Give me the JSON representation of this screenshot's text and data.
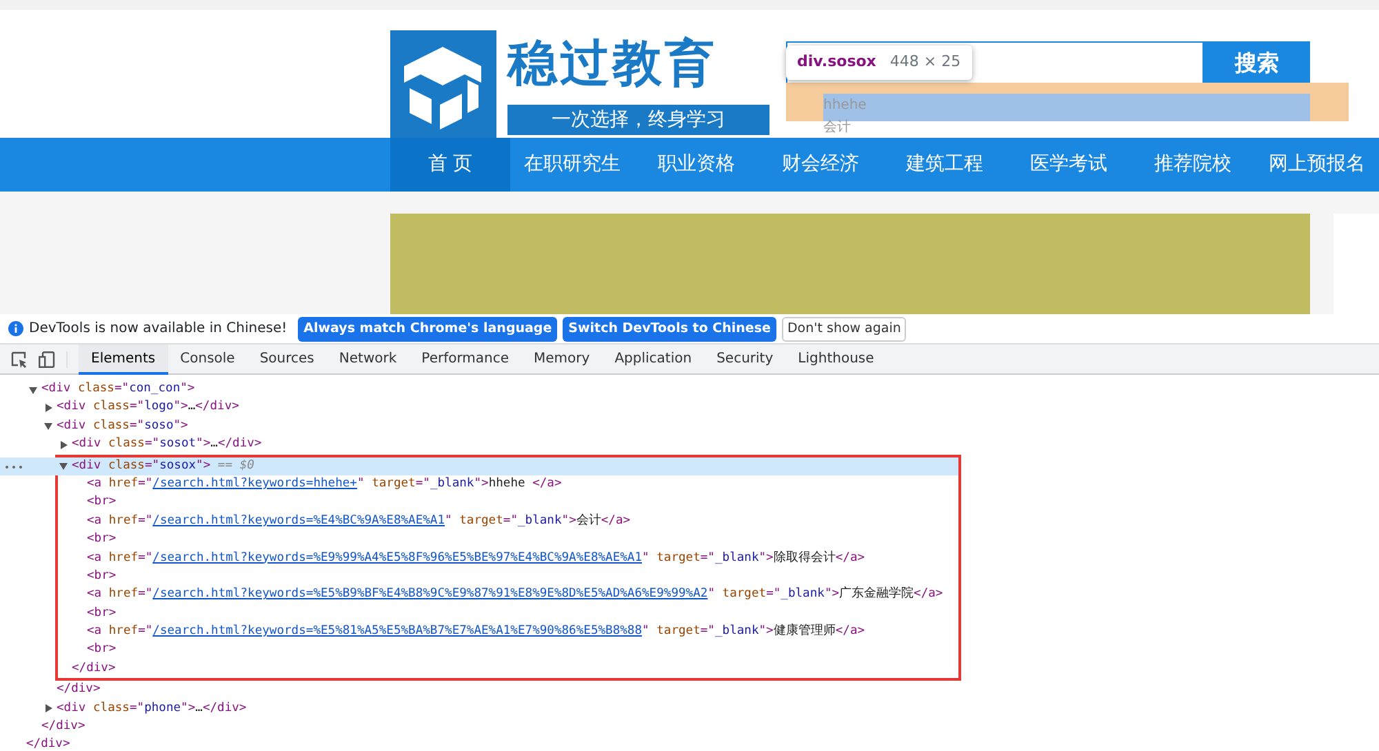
{
  "site": {
    "logo_title": "稳过教育",
    "slogan": "一次选择，终身学习",
    "search": {
      "button": "搜索",
      "tooltip": {
        "selector": "div.sosox",
        "size": "448 × 25"
      }
    },
    "suggestions": [
      "hhehe",
      "会计"
    ],
    "nav": [
      {
        "label": "首 页",
        "selected": true
      },
      {
        "label": "在职研究生",
        "selected": false
      },
      {
        "label": "职业资格",
        "selected": false
      },
      {
        "label": "财会经济",
        "selected": false
      },
      {
        "label": "建筑工程",
        "selected": false
      },
      {
        "label": "医学考试",
        "selected": false
      },
      {
        "label": "推荐院校",
        "selected": false
      },
      {
        "label": "网上预报名",
        "selected": false
      }
    ]
  },
  "infobar": {
    "message": "DevTools is now available in Chinese!",
    "buttons": [
      {
        "label": "Always match Chrome's language",
        "kind": "primary"
      },
      {
        "label": "Switch DevTools to Chinese",
        "kind": "primary"
      },
      {
        "label": "Don't show again",
        "kind": "secondary"
      }
    ]
  },
  "devtools_tabs": [
    {
      "label": "Elements",
      "selected": true
    },
    {
      "label": "Console",
      "selected": false
    },
    {
      "label": "Sources",
      "selected": false
    },
    {
      "label": "Network",
      "selected": false
    },
    {
      "label": "Performance",
      "selected": false
    },
    {
      "label": "Memory",
      "selected": false
    },
    {
      "label": "Application",
      "selected": false
    },
    {
      "label": "Security",
      "selected": false
    },
    {
      "label": "Lighthouse",
      "selected": false
    }
  ],
  "dom": {
    "nodes": [
      {
        "expanded": true,
        "selected": false,
        "highlighted": false,
        "parts": [
          {
            "kind": "tag",
            "text": "<div "
          },
          {
            "kind": "attr",
            "text": "class"
          },
          {
            "kind": "tag",
            "text": "=\""
          },
          {
            "kind": "val",
            "text": "con_con"
          },
          {
            "kind": "tag",
            "text": "\">"
          }
        ],
        "closing": "</div>",
        "children": [
          {
            "expanded": false,
            "selected": false,
            "highlighted": false,
            "parts": [
              {
                "kind": "tag",
                "text": "<div "
              },
              {
                "kind": "attr",
                "text": "class"
              },
              {
                "kind": "tag",
                "text": "=\""
              },
              {
                "kind": "val",
                "text": "logo"
              },
              {
                "kind": "tag",
                "text": "\">"
              },
              {
                "kind": "text",
                "text": "…"
              },
              {
                "kind": "tag",
                "text": "</div>"
              }
            ]
          },
          {
            "expanded": true,
            "selected": false,
            "highlighted": false,
            "parts": [
              {
                "kind": "tag",
                "text": "<div "
              },
              {
                "kind": "attr",
                "text": "class"
              },
              {
                "kind": "tag",
                "text": "=\""
              },
              {
                "kind": "val",
                "text": "soso"
              },
              {
                "kind": "tag",
                "text": "\">"
              }
            ],
            "closing": "</div>",
            "children": [
              {
                "expanded": false,
                "selected": false,
                "highlighted": false,
                "parts": [
                  {
                    "kind": "tag",
                    "text": "<div "
                  },
                  {
                    "kind": "attr",
                    "text": "class"
                  },
                  {
                    "kind": "tag",
                    "text": "=\""
                  },
                  {
                    "kind": "val",
                    "text": "sosot"
                  },
                  {
                    "kind": "tag",
                    "text": "\">"
                  },
                  {
                    "kind": "text",
                    "text": "…"
                  },
                  {
                    "kind": "tag",
                    "text": "</div>"
                  }
                ]
              },
              {
                "expanded": true,
                "selected": true,
                "highlighted": true,
                "parts": [
                  {
                    "kind": "tag",
                    "text": "<div "
                  },
                  {
                    "kind": "attr",
                    "text": "class"
                  },
                  {
                    "kind": "tag",
                    "text": "=\""
                  },
                  {
                    "kind": "val",
                    "text": "sosox"
                  },
                  {
                    "kind": "tag",
                    "text": "\">"
                  },
                  {
                    "kind": "dim",
                    "text": " == $0"
                  }
                ],
                "closing": "</div>",
                "children": [
                  {
                    "parts": [
                      {
                        "kind": "tag",
                        "text": "<a "
                      },
                      {
                        "kind": "attr",
                        "text": "href"
                      },
                      {
                        "kind": "tag",
                        "text": "=\""
                      },
                      {
                        "kind": "link",
                        "text": "/search.html?keywords=hhehe+"
                      },
                      {
                        "kind": "tag",
                        "text": "\" "
                      },
                      {
                        "kind": "attr",
                        "text": "target"
                      },
                      {
                        "kind": "tag",
                        "text": "=\""
                      },
                      {
                        "kind": "val",
                        "text": "_blank"
                      },
                      {
                        "kind": "tag",
                        "text": "\">"
                      },
                      {
                        "kind": "text",
                        "text": "hhehe "
                      },
                      {
                        "kind": "tag",
                        "text": "</a>"
                      }
                    ]
                  },
                  {
                    "parts": [
                      {
                        "kind": "tag",
                        "text": "<br>"
                      }
                    ]
                  },
                  {
                    "parts": [
                      {
                        "kind": "tag",
                        "text": "<a "
                      },
                      {
                        "kind": "attr",
                        "text": "href"
                      },
                      {
                        "kind": "tag",
                        "text": "=\""
                      },
                      {
                        "kind": "link",
                        "text": "/search.html?keywords=%E4%BC%9A%E8%AE%A1"
                      },
                      {
                        "kind": "tag",
                        "text": "\" "
                      },
                      {
                        "kind": "attr",
                        "text": "target"
                      },
                      {
                        "kind": "tag",
                        "text": "=\""
                      },
                      {
                        "kind": "val",
                        "text": "_blank"
                      },
                      {
                        "kind": "tag",
                        "text": "\">"
                      },
                      {
                        "kind": "text",
                        "text": "会计"
                      },
                      {
                        "kind": "tag",
                        "text": "</a>"
                      }
                    ]
                  },
                  {
                    "parts": [
                      {
                        "kind": "tag",
                        "text": "<br>"
                      }
                    ]
                  },
                  {
                    "parts": [
                      {
                        "kind": "tag",
                        "text": "<a "
                      },
                      {
                        "kind": "attr",
                        "text": "href"
                      },
                      {
                        "kind": "tag",
                        "text": "=\""
                      },
                      {
                        "kind": "link",
                        "text": "/search.html?keywords=%E9%99%A4%E5%8F%96%E5%BE%97%E4%BC%9A%E8%AE%A1"
                      },
                      {
                        "kind": "tag",
                        "text": "\" "
                      },
                      {
                        "kind": "attr",
                        "text": "target"
                      },
                      {
                        "kind": "tag",
                        "text": "=\""
                      },
                      {
                        "kind": "val",
                        "text": "_blank"
                      },
                      {
                        "kind": "tag",
                        "text": "\">"
                      },
                      {
                        "kind": "text",
                        "text": "除取得会计"
                      },
                      {
                        "kind": "tag",
                        "text": "</a>"
                      }
                    ]
                  },
                  {
                    "parts": [
                      {
                        "kind": "tag",
                        "text": "<br>"
                      }
                    ]
                  },
                  {
                    "parts": [
                      {
                        "kind": "tag",
                        "text": "<a "
                      },
                      {
                        "kind": "attr",
                        "text": "href"
                      },
                      {
                        "kind": "tag",
                        "text": "=\""
                      },
                      {
                        "kind": "link",
                        "text": "/search.html?keywords=%E5%B9%BF%E4%B8%9C%E9%87%91%E8%9E%8D%E5%AD%A6%E9%99%A2"
                      },
                      {
                        "kind": "tag",
                        "text": "\" "
                      },
                      {
                        "kind": "attr",
                        "text": "target"
                      },
                      {
                        "kind": "tag",
                        "text": "=\""
                      },
                      {
                        "kind": "val",
                        "text": "_blank"
                      },
                      {
                        "kind": "tag",
                        "text": "\">"
                      },
                      {
                        "kind": "text",
                        "text": "广东金融学院"
                      },
                      {
                        "kind": "tag",
                        "text": "</a>"
                      }
                    ]
                  },
                  {
                    "parts": [
                      {
                        "kind": "tag",
                        "text": "<br>"
                      }
                    ]
                  },
                  {
                    "parts": [
                      {
                        "kind": "tag",
                        "text": "<a "
                      },
                      {
                        "kind": "attr",
                        "text": "href"
                      },
                      {
                        "kind": "tag",
                        "text": "=\""
                      },
                      {
                        "kind": "link",
                        "text": "/search.html?keywords=%E5%81%A5%E5%BA%B7%E7%AE%A1%E7%90%86%E5%B8%88"
                      },
                      {
                        "kind": "tag",
                        "text": "\" "
                      },
                      {
                        "kind": "attr",
                        "text": "target"
                      },
                      {
                        "kind": "tag",
                        "text": "=\""
                      },
                      {
                        "kind": "val",
                        "text": "_blank"
                      },
                      {
                        "kind": "tag",
                        "text": "\">"
                      },
                      {
                        "kind": "text",
                        "text": "健康管理师"
                      },
                      {
                        "kind": "tag",
                        "text": "</a>"
                      }
                    ]
                  },
                  {
                    "parts": [
                      {
                        "kind": "tag",
                        "text": "<br>"
                      }
                    ]
                  }
                ]
              }
            ]
          },
          {
            "expanded": false,
            "selected": false,
            "highlighted": false,
            "parts": [
              {
                "kind": "tag",
                "text": "<div "
              },
              {
                "kind": "attr",
                "text": "class"
              },
              {
                "kind": "tag",
                "text": "=\""
              },
              {
                "kind": "val",
                "text": "phone"
              },
              {
                "kind": "tag",
                "text": "\">"
              },
              {
                "kind": "text",
                "text": "…"
              },
              {
                "kind": "tag",
                "text": "</div>"
              }
            ]
          }
        ]
      }
    ],
    "trailing_close": "</div>"
  }
}
